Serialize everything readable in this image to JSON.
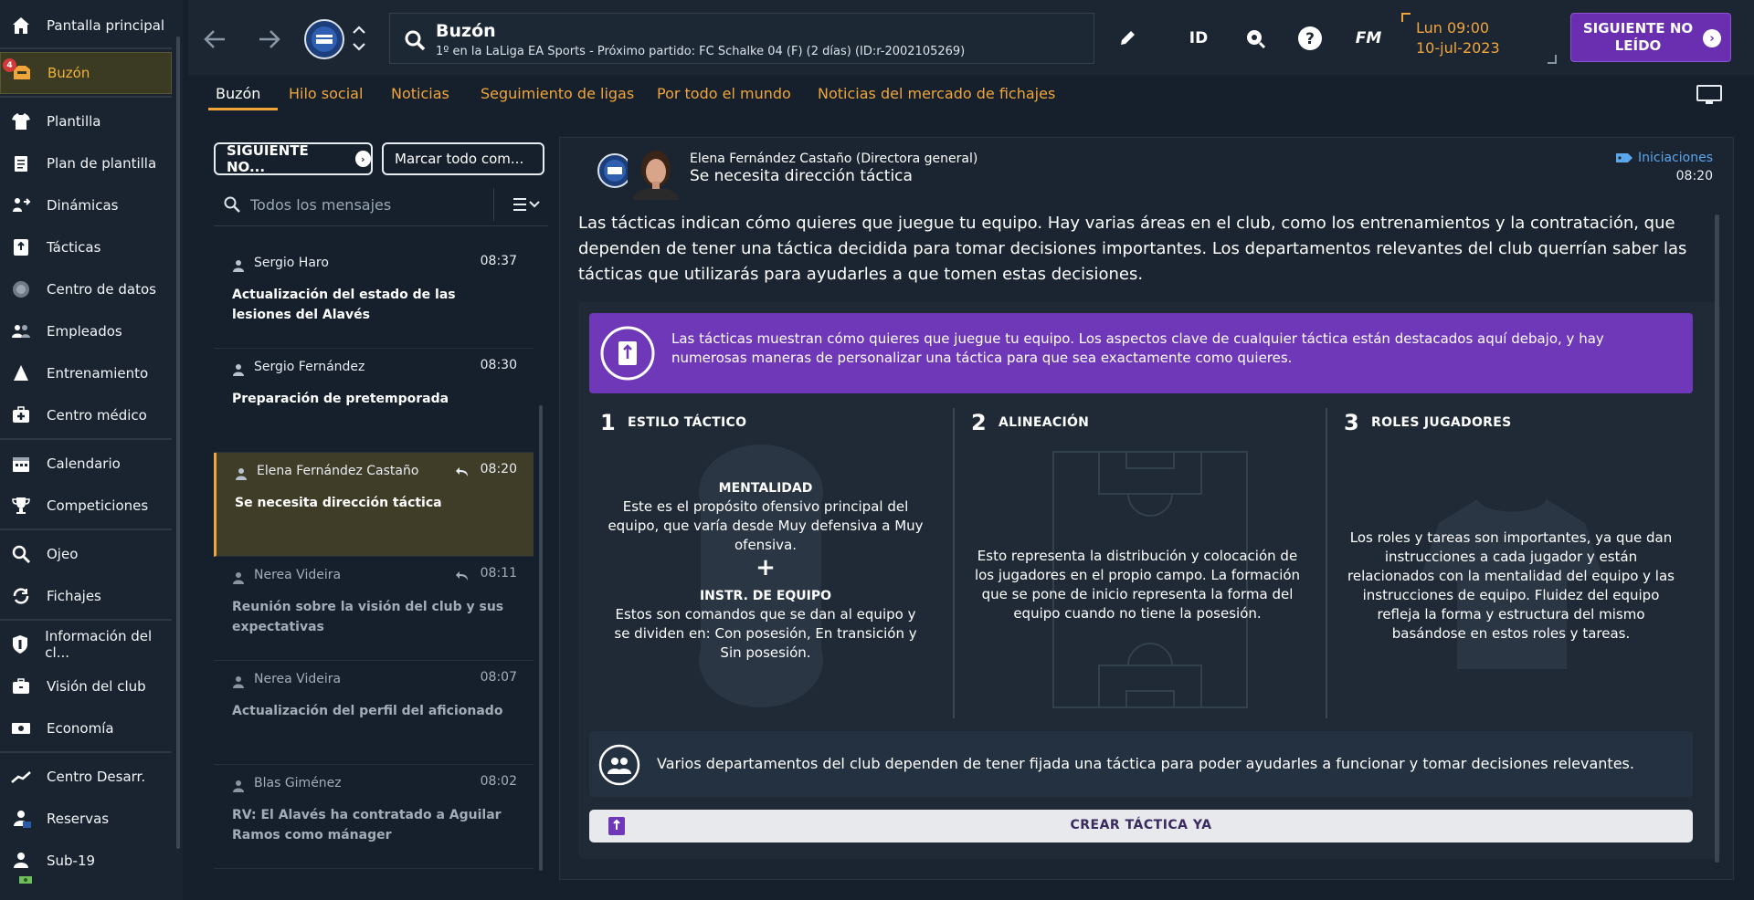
{
  "sidebar": {
    "items": [
      {
        "label": "Pantalla principal",
        "icon": "home-icon"
      },
      {
        "label": "Buzón",
        "icon": "inbox-icon",
        "badge": "4"
      },
      {
        "label": "Plantilla",
        "icon": "shirt-icon"
      },
      {
        "label": "Plan de plantilla",
        "icon": "clipboard-icon"
      },
      {
        "label": "Dinámicas",
        "icon": "dynamics-icon"
      },
      {
        "label": "Tácticas",
        "icon": "tactics-icon"
      },
      {
        "label": "Centro de datos",
        "icon": "data-icon"
      },
      {
        "label": "Empleados",
        "icon": "staff-icon"
      },
      {
        "label": "Entrenamiento",
        "icon": "training-icon"
      },
      {
        "label": "Centro médico",
        "icon": "medical-icon"
      },
      {
        "label": "Calendario",
        "icon": "calendar-icon"
      },
      {
        "label": "Competiciones",
        "icon": "trophy-icon"
      },
      {
        "label": "Ojeo",
        "icon": "scout-icon"
      },
      {
        "label": "Fichajes",
        "icon": "transfers-icon"
      },
      {
        "label": "Información del cl...",
        "icon": "club-info-icon"
      },
      {
        "label": "Visión del club",
        "icon": "briefcase-icon"
      },
      {
        "label": "Economía",
        "icon": "finance-icon"
      },
      {
        "label": "Centro Desarr.",
        "icon": "development-icon"
      },
      {
        "label": "Reservas",
        "icon": "reserves-icon"
      },
      {
        "label": "Sub-19",
        "icon": "u19-icon"
      }
    ]
  },
  "topbar": {
    "title": "Buzón",
    "subtitle": "1º en la LaLiga EA Sports - Próximo partido: FC Schalke 04 (F) (2 días) (ID:r-2002105269)",
    "id_label": "ID",
    "fm_label": "FM",
    "clock_day": "Lun 09:00",
    "clock_date": "10-jul-2023",
    "next_unread_label": "SIGUIENTE NO LEÍDO"
  },
  "tabs": [
    {
      "label": "Buzón"
    },
    {
      "label": "Hilo social"
    },
    {
      "label": "Noticias"
    },
    {
      "label": "Seguimiento de ligas"
    },
    {
      "label": "Por todo el mundo"
    },
    {
      "label": "Noticias del mercado de fichajes"
    }
  ],
  "inbox": {
    "next_unread_btn": "SIGUIENTE NO...",
    "mark_all_btn": "Marcar todo com...",
    "search_placeholder": "Todos los mensajes",
    "messages": [
      {
        "sender": "Sergio Haro",
        "time": "08:37",
        "subject": "Actualización del estado de las lesiones del Alavés"
      },
      {
        "sender": "Sergio Fernández",
        "time": "08:30",
        "subject": "Preparación de pretemporada"
      },
      {
        "sender": "Elena Fernández Castaño",
        "time": "08:20",
        "subject": "Se necesita dirección táctica"
      },
      {
        "sender": "Nerea Videira",
        "time": "08:11",
        "subject": "Reunión sobre la visión del club y sus expectativas"
      },
      {
        "sender": "Nerea Videira",
        "time": "08:07",
        "subject": "Actualización del perfil del aficionado"
      },
      {
        "sender": "Blas Giménez",
        "time": "08:02",
        "subject": "RV: El Alavés ha contratado a Aguilar Ramos como mánager"
      }
    ]
  },
  "message": {
    "from": "Elena Fernández Castaño  (Directora general)",
    "subject": "Se necesita dirección táctica",
    "tag": "Iniciaciones",
    "time": "08:20",
    "intro": "Las tácticas indican cómo quieres que juegue tu equipo. Hay varias áreas en el club, como los entrenamientos y la contratación, que dependen de tener una táctica decidida para tomar decisiones importantes. Los departamentos relevantes del club querrían saber las tácticas que utilizarás para ayudarles a que tomen estas decisiones.",
    "banner": "Las tácticas muestran cómo quieres que juegue tu equipo. Los aspectos clave de cualquier táctica están destacados aquí debajo, y hay numerosas maneras de personalizar una táctica para que sea exactamente como quieres.",
    "columns": [
      {
        "num": "1",
        "heading": "ESTILO TÁCTICO",
        "sub1_title": "MENTALIDAD",
        "sub1_text": "Este es el propósito ofensivo principal del equipo, que varía desde Muy defensiva a Muy ofensiva.",
        "plus": "+",
        "sub2_title": "INSTR. DE EQUIPO",
        "sub2_text": "Estos son comandos que se dan al equipo y se dividen en: Con posesión, En transición y Sin posesión."
      },
      {
        "num": "2",
        "heading": "ALINEACIÓN",
        "text": "Esto representa la distribución y colocación de los jugadores en el propio campo. La formación que se pone de inicio representa la forma del equipo cuando no tiene la posesión."
      },
      {
        "num": "3",
        "heading": "ROLES JUGADORES",
        "text": "Los roles y tareas son importantes, ya que dan instrucciones a cada jugador y están relacionados con la mentalidad del equipo y las instrucciones de equipo. Fluidez del equipo refleja la forma y estructura del mismo basándose en estos roles y tareas."
      }
    ],
    "info": "Varios departamentos del club dependen de tener fijada una táctica para poder ayudarles a funcionar y tomar decisiones relevantes.",
    "create_btn": "CREAR TÁCTICA YA"
  },
  "colors": {
    "accent": "#f0a53a",
    "purple": "#6f38b8",
    "link_blue": "#5aa7ee",
    "background": "#16202c"
  }
}
